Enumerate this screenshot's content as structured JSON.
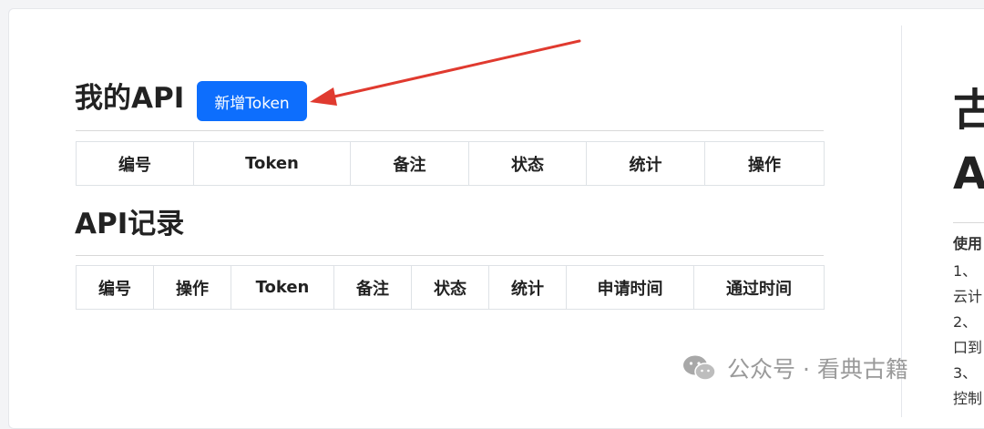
{
  "api_section": {
    "title": "我的API",
    "add_token_button": "新增Token",
    "columns": [
      "编号",
      "Token",
      "备注",
      "状态",
      "统计",
      "操作"
    ]
  },
  "record_section": {
    "title": "API记录",
    "columns": [
      "编号",
      "操作",
      "Token",
      "备注",
      "状态",
      "统计",
      "申请时间",
      "通过时间"
    ]
  },
  "side_panel": {
    "big_line_1": "古",
    "big_line_2": "A",
    "lines": [
      "使用",
      "1、",
      "云计",
      "2、",
      "口到",
      "3、",
      "控制"
    ]
  },
  "watermark": {
    "text": "公众号 · 看典古籍"
  },
  "colors": {
    "primary": "#0d6efd",
    "arrow": "#e03a2f",
    "watermark": "#9a9a9a"
  }
}
